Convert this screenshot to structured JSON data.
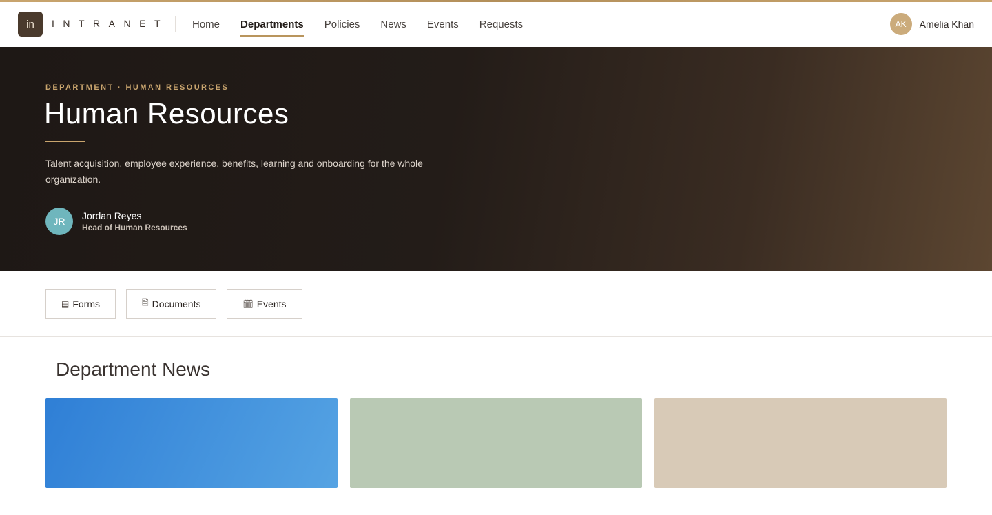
{
  "brand": {
    "logo_text": "in",
    "name": "INTRANET"
  },
  "nav": {
    "items": [
      {
        "label": "Home"
      },
      {
        "label": "Departments"
      },
      {
        "label": "Policies"
      },
      {
        "label": "News"
      },
      {
        "label": "Events"
      },
      {
        "label": "Requests"
      }
    ],
    "active": "Departments"
  },
  "user": {
    "initials": "AK",
    "name": "Amelia Khan",
    "avatar_color": "#cbab7b"
  },
  "hero": {
    "eyebrow": "DEPARTMENT · HUMAN RESOURCES",
    "title": "Human Resources",
    "description": "Talent acquisition, employee experience, benefits, learning and onboarding for the whole organization.",
    "head": {
      "initials": "JR",
      "name": "Jordan Reyes",
      "role": "Head of Human Resources",
      "avatar_color": "#6fb6bd"
    }
  },
  "actions": [
    {
      "icon": "forms-icon",
      "glyph": "▤",
      "label": "Forms"
    },
    {
      "icon": "document-icon",
      "glyph": "🗎",
      "label": "Documents"
    },
    {
      "icon": "calendar-icon",
      "glyph": "🗓",
      "label": "Events"
    }
  ],
  "news": {
    "title": "Department News",
    "cards": [
      {
        "color_start": "#2f7fd6",
        "color_end": "#55a3e3"
      },
      {
        "color_start": "#b9c9b4",
        "color_end": "#b9c9b4"
      },
      {
        "color_start": "#d8cab7",
        "color_end": "#d8cab7"
      }
    ]
  },
  "colors": {
    "accent": "#c9a56e",
    "hero_dark": "#1e1815",
    "hero_light": "#5c4631"
  }
}
